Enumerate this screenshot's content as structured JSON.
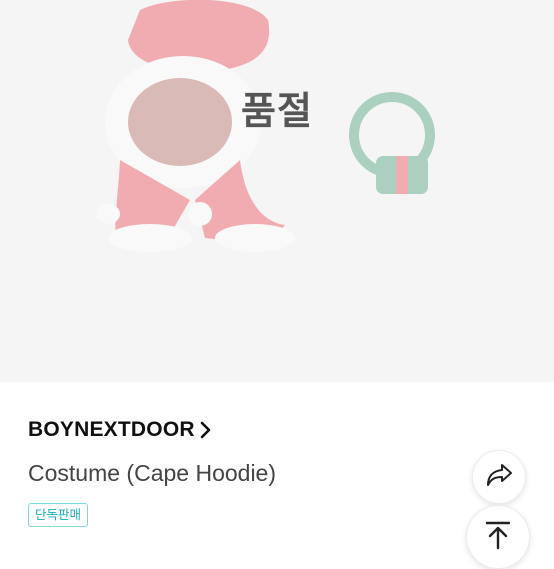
{
  "product": {
    "soldout_label": "품절",
    "brand": "BOYNEXTDOOR",
    "name": "Costume (Cape Hoodie)",
    "badge": "단독판매"
  },
  "icons": {
    "brand_link": "chevron-right-icon",
    "share": "share-arrow-icon",
    "scroll_top": "arrow-up-to-top-icon"
  },
  "colors": {
    "badge_text": "#1aaeb0",
    "badge_border": "#7fd8d9",
    "costume_red": "#e8505b",
    "wreath_green": "#4e9f7a"
  }
}
